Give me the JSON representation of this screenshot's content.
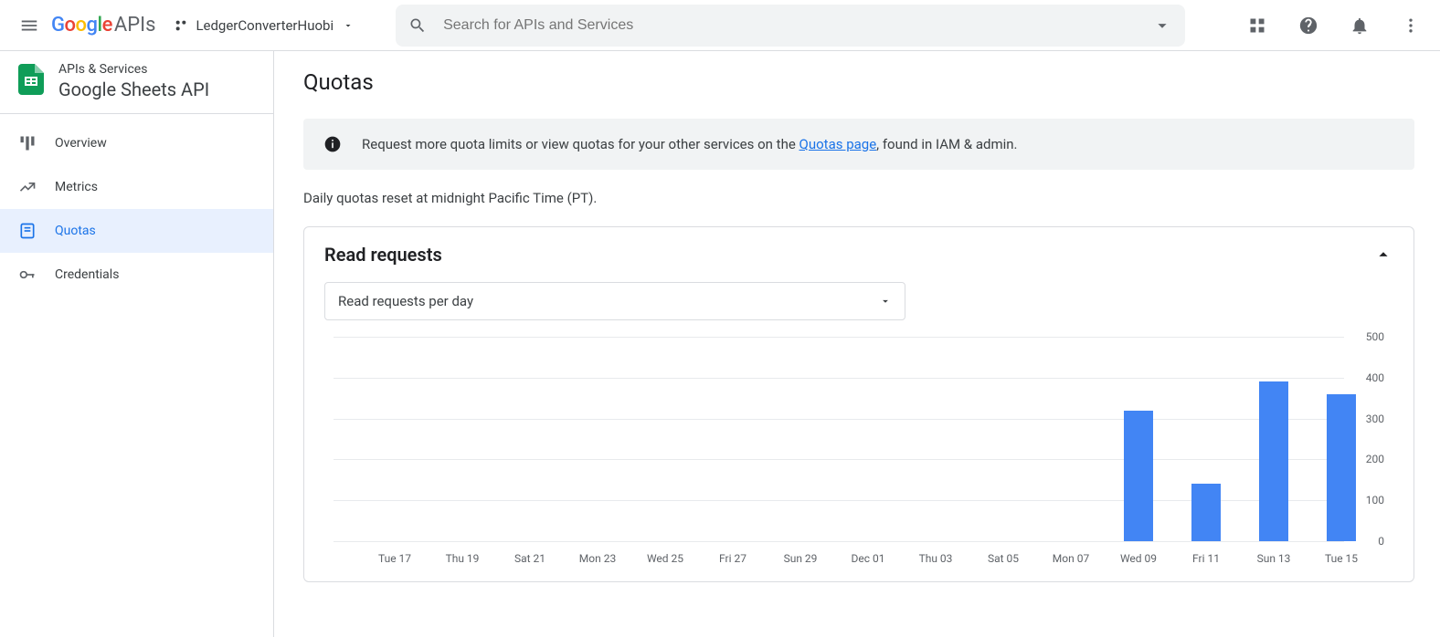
{
  "topbar": {
    "brand_apis": "APIs",
    "project_name": "LedgerConverterHuobi",
    "search_placeholder": "Search for APIs and Services"
  },
  "sidebar": {
    "crumb": "APIs & Services",
    "title": "Google Sheets API",
    "items": [
      {
        "label": "Overview"
      },
      {
        "label": "Metrics"
      },
      {
        "label": "Quotas"
      },
      {
        "label": "Credentials"
      }
    ]
  },
  "main": {
    "page_title": "Quotas",
    "info_prefix": "Request more quota limits or view quotas for your other services on the ",
    "info_link": "Quotas page",
    "info_suffix": ", found in IAM & admin.",
    "reset_note": "Daily quotas reset at midnight Pacific Time (PT).",
    "card_title": "Read requests",
    "dropdown_value": "Read requests per day"
  },
  "chart_data": {
    "type": "bar",
    "title": "",
    "xlabel": "",
    "ylabel": "",
    "ylim": [
      0,
      500
    ],
    "y_ticks": [
      0,
      100,
      200,
      300,
      400,
      500
    ],
    "categories": [
      "Tue 17",
      "Thu 19",
      "Sat 21",
      "Mon 23",
      "Wed 25",
      "Fri 27",
      "Sun 29",
      "Dec 01",
      "Thu 03",
      "Sat 05",
      "Mon 07",
      "Wed 09",
      "Fri 11",
      "Sun 13",
      "Tue 15"
    ],
    "values": [
      0,
      0,
      0,
      0,
      0,
      0,
      0,
      0,
      0,
      0,
      0,
      320,
      140,
      390,
      360
    ],
    "secondary_values": [
      0,
      0,
      0,
      0,
      0,
      0,
      0,
      0,
      0,
      0,
      0,
      0,
      20,
      0,
      0
    ]
  }
}
